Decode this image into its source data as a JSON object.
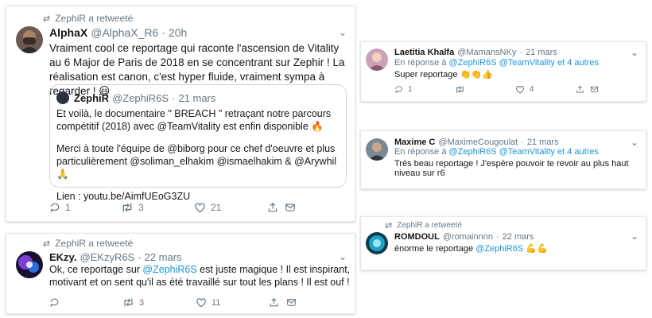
{
  "tweets": {
    "t1": {
      "retweet_label": "ZephiR a retweeté",
      "name": "AlphaX",
      "handle": "@AlphaX_R6",
      "time": "20h",
      "text": "Vraiment cool ce reportage qui raconte l'ascension de Vitality au 6 Major de Paris de 2018 en se concentrant sur Zephir ! La réalisation est canon, c'est hyper fluide, vraiment sympa à regarder !",
      "emoji": "😃",
      "quote": {
        "name": "ZephiR",
        "handle": "@ZephiR6S",
        "time": "21 mars",
        "line1": "Et voilà, le documentaire \" BREACH \" retraçant notre parcours compétitif (2018) avec @TeamVitality est enfin disponible",
        "line1_emoji": "🔥",
        "line2": "Merci à toute l'équipe de @biborg pour ce chef d'oeuvre et plus particulièrement @soliman_elhakim @ismaelhakim & @Arywhil",
        "line2_emoji": "🙏",
        "line3": "Lien : youtu.be/AimfUEoG3ZU"
      },
      "replies": "1",
      "retweets": "3",
      "likes": "21"
    },
    "t2": {
      "retweet_label": "ZephiR a retweeté",
      "name": "EKzy.",
      "handle": "@EKzyR6S",
      "time": "22 mars",
      "text_pre": "Ok, ce reportage sur ",
      "mention": "@ZephiR6S",
      "text_post": " est juste magique ! Il est inspirant, motivant et on sent qu'il as été travaillé sur tout les plans ! Il est ouf !",
      "replies": "",
      "retweets": "3",
      "likes": "11"
    },
    "t3": {
      "name": "Laetitia Khalfa",
      "handle": "@MamansNKy",
      "time": "21 mars",
      "reply_prefix": "En réponse à",
      "reply_mentions": "@ZephiR6S @TeamVitality",
      "reply_suffix": "et 4 autres",
      "text": "Super reportage",
      "emoji": "👏👏👍",
      "replies": "1",
      "retweets": "",
      "likes": "4"
    },
    "t4": {
      "name": "Maxime C",
      "handle": "@MaximeCougoulat",
      "time": "21 mars",
      "reply_prefix": "En réponse à",
      "reply_mentions": "@ZephiR6S @TeamVitality",
      "reply_suffix": "et 4 autres",
      "text": "Très beau reportage ! J'espère pouvoir te revoir au plus haut niveau sur r6"
    },
    "t5": {
      "retweet_label": "ZephiR a retweeté",
      "name": "ROMDOUL",
      "handle": "@romainnnn",
      "time": "22 mars",
      "text_pre": "énorme le reportage ",
      "mention": "@ZephiR6S",
      "emoji": "💪💪"
    }
  },
  "sep": "·",
  "icons": [
    "retweet-icon",
    "reply-icon",
    "like-icon",
    "share-icon",
    "dm-icon",
    "chevron-down-icon"
  ]
}
